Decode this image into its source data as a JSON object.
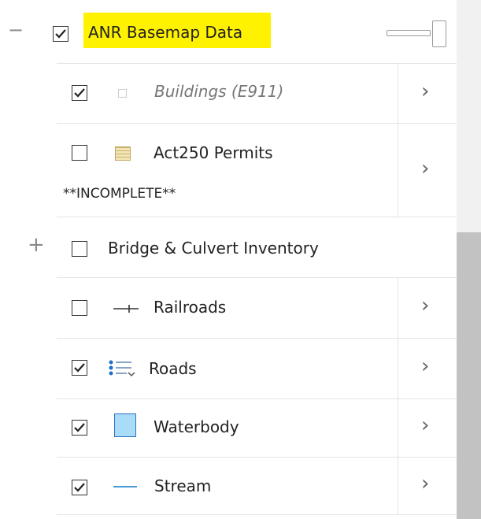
{
  "layers": {
    "group": {
      "label": "ANR Basemap Data",
      "checked": true,
      "expanded": true,
      "highlight": "#fff200"
    },
    "items": [
      {
        "label": "Buildings (E911)",
        "italic": true,
        "checked": true,
        "icon": "square-outline-icon"
      },
      {
        "label": "Act250 Permits",
        "sub": "**INCOMPLETE**",
        "checked": false,
        "icon": "hatched-swatch-icon"
      },
      {
        "label": "Bridge & Culvert Inventory",
        "checked": false,
        "expander": "+"
      },
      {
        "label": "Railroads",
        "checked": false,
        "icon": "railroad-line-icon"
      },
      {
        "label": "Roads",
        "checked": true,
        "icon": "legend-list-icon"
      },
      {
        "label": "Waterbody",
        "checked": true,
        "icon": "waterbody-swatch-icon",
        "color": "#a9dcf6"
      },
      {
        "label": "Stream",
        "checked": true,
        "icon": "stream-line-icon",
        "color": "#4a9ad8"
      }
    ]
  },
  "ui": {
    "collapse_symbol": "−",
    "chevron": "›"
  }
}
